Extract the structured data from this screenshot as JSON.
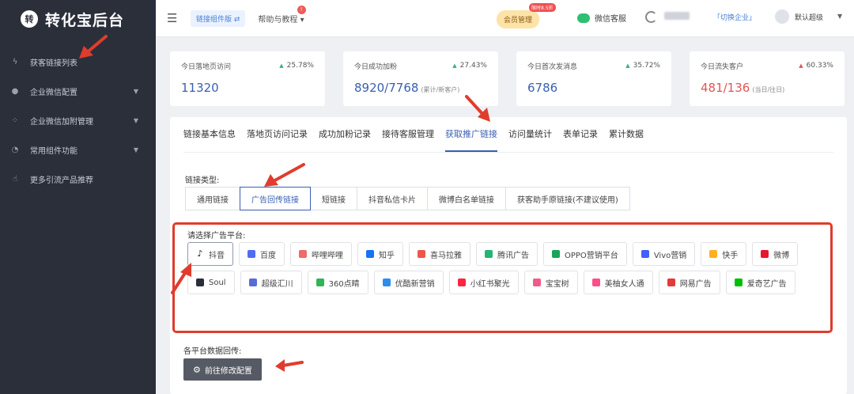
{
  "brand": {
    "logo_text": "转",
    "title": "转化宝后台"
  },
  "sidebar": {
    "items": [
      {
        "label": "获客链接列表",
        "icon": "lightning-icon",
        "glyph": "ϟ",
        "has_arrow": false
      },
      {
        "label": "企业微信配置",
        "icon": "chat-icon",
        "glyph": "●",
        "has_arrow": true
      },
      {
        "label": "企业微信加附管理",
        "icon": "users-icon",
        "glyph": "⁘",
        "has_arrow": true
      },
      {
        "label": "常用组件功能",
        "icon": "gauge-icon",
        "glyph": "◔",
        "has_arrow": true
      },
      {
        "label": "更多引流产品推荐",
        "icon": "thumb-icon",
        "glyph": "☝",
        "has_arrow": false
      }
    ]
  },
  "header": {
    "tag": "链接组件版 ⇄",
    "help": "帮助与教程",
    "help_badge": "!",
    "member": "会员管理",
    "member_badge": "限时8.5折",
    "wechat_service": "微信客服",
    "switch_company": "「切换企业」",
    "user": "默认超级"
  },
  "stats": [
    {
      "label": "今日落地页访问",
      "pct": "25.78%",
      "dir": "up",
      "value": "11320",
      "sub": ""
    },
    {
      "label": "今日成功加粉",
      "pct": "27.43%",
      "dir": "up",
      "value": "8920/7768",
      "sub": "(累计/新客户)"
    },
    {
      "label": "今日首次发消息",
      "pct": "35.72%",
      "dir": "up",
      "value": "6786",
      "sub": ""
    },
    {
      "label": "今日流失客户",
      "pct": "60.33%",
      "dir": "down",
      "value": "481/136",
      "sub": "(当日/往日)"
    }
  ],
  "tabs": [
    {
      "label": "链接基本信息",
      "active": false
    },
    {
      "label": "落地页访问记录",
      "active": false
    },
    {
      "label": "成功加粉记录",
      "active": false
    },
    {
      "label": "接待客服管理",
      "active": false
    },
    {
      "label": "获取推广链接",
      "active": true
    },
    {
      "label": "访问量统计",
      "active": false
    },
    {
      "label": "表单记录",
      "active": false
    },
    {
      "label": "累计数据",
      "active": false
    }
  ],
  "link_type": {
    "label": "链接类型:",
    "options": [
      {
        "label": "通用链接",
        "active": false
      },
      {
        "label": "广告回传链接",
        "active": true
      },
      {
        "label": "短链接",
        "active": false
      },
      {
        "label": "抖音私信卡片",
        "active": false
      },
      {
        "label": "微博白名单链接",
        "active": false
      },
      {
        "label": "获客助手原链接(不建议使用)",
        "active": false
      }
    ]
  },
  "ad_platform": {
    "label": "请选择广告平台:",
    "options": [
      {
        "label": "抖音",
        "icon": "tiktok-icon",
        "color": "#111111",
        "glyph": "♪",
        "active": true
      },
      {
        "label": "百度",
        "icon": "baidu-icon",
        "color": "#4e6ef2",
        "glyph": "",
        "active": false
      },
      {
        "label": "哔哩哔哩",
        "icon": "bilibili-icon",
        "color": "#f06a6a",
        "glyph": "",
        "active": false
      },
      {
        "label": "知乎",
        "icon": "zhihu-icon",
        "color": "#1772f6",
        "glyph": "",
        "active": false
      },
      {
        "label": "喜马拉雅",
        "icon": "ximalaya-icon",
        "color": "#f0564a",
        "glyph": "",
        "active": false
      },
      {
        "label": "腾讯广告",
        "icon": "tencent-icon",
        "color": "#22b573",
        "glyph": "",
        "active": false
      },
      {
        "label": "OPPO营销平台",
        "icon": "oppo-icon",
        "color": "#19a55a",
        "glyph": "",
        "active": false
      },
      {
        "label": "Vivo营销",
        "icon": "vivo-icon",
        "color": "#415fff",
        "glyph": "",
        "active": false
      },
      {
        "label": "快手",
        "icon": "kuaishou-icon",
        "color": "#ffb020",
        "glyph": "",
        "active": false
      },
      {
        "label": "微博",
        "icon": "weibo-icon",
        "color": "#e6162d",
        "glyph": "",
        "active": false
      },
      {
        "label": "Soul",
        "icon": "soul-icon",
        "color": "#2b2f3a",
        "glyph": "",
        "active": false
      },
      {
        "label": "超级汇川",
        "icon": "huichuan-icon",
        "color": "#5a6bd6",
        "glyph": "",
        "active": false
      },
      {
        "label": "360点睛",
        "icon": "360-icon",
        "color": "#2fb45a",
        "glyph": "",
        "active": false
      },
      {
        "label": "优酷新营销",
        "icon": "youku-icon",
        "color": "#2d8cf0",
        "glyph": "",
        "active": false
      },
      {
        "label": "小红书聚光",
        "icon": "xiaohongshu-icon",
        "color": "#ff2442",
        "glyph": "",
        "active": false
      },
      {
        "label": "宝宝树",
        "icon": "babytree-icon",
        "color": "#f25a8a",
        "glyph": "",
        "active": false
      },
      {
        "label": "美柚女人通",
        "icon": "meiyou-icon",
        "color": "#ff4d88",
        "glyph": "",
        "active": false
      },
      {
        "label": "网易广告",
        "icon": "netease-icon",
        "color": "#e33a3a",
        "glyph": "",
        "active": false
      },
      {
        "label": "爱奇艺广告",
        "icon": "iqiyi-icon",
        "color": "#00be06",
        "glyph": "",
        "active": false
      }
    ]
  },
  "data_return": {
    "label": "各平台数据回传:",
    "button": "前往修改配置"
  },
  "colors": {
    "accent": "#3a5fb0",
    "annotation": "#e03c2d",
    "sidebar": "#2b2f3a"
  }
}
